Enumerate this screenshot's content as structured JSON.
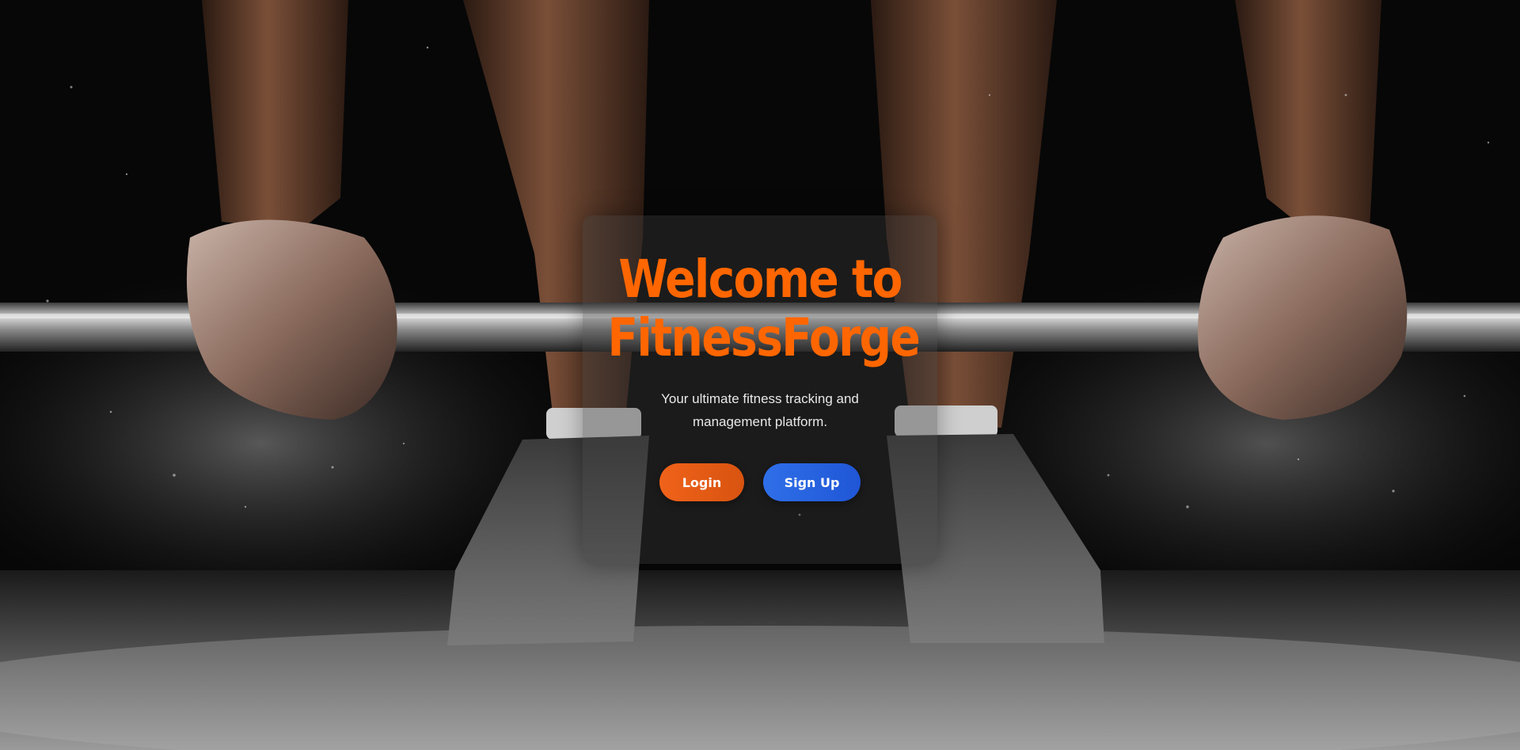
{
  "hero": {
    "title_line1": "Welcome to",
    "title_line2": "FitnessForge",
    "subtitle": "Your ultimate fitness tracking and management platform."
  },
  "actions": {
    "login_label": "Login",
    "signup_label": "Sign Up"
  },
  "colors": {
    "accent_orange": "#ff6600",
    "login_button": "#e85d17",
    "signup_button": "#2563eb",
    "subtitle_text": "#e8e8e8",
    "button_text": "#ffffff"
  },
  "background": {
    "depiction": "barbell-deadlift-photo"
  }
}
